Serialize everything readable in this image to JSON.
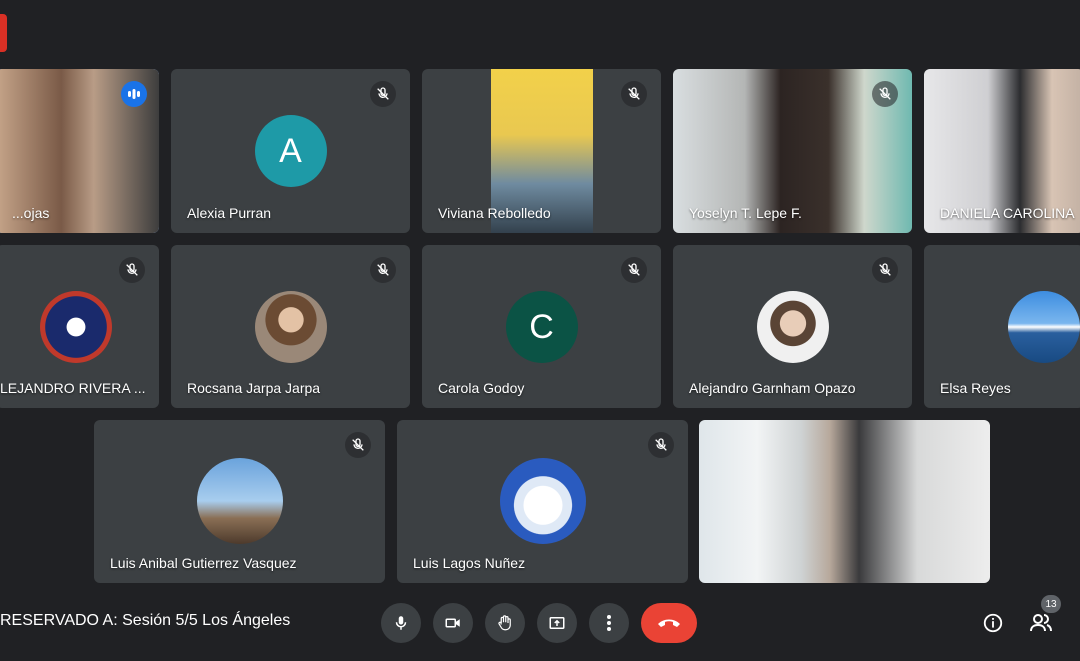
{
  "meeting": {
    "title": "RESERVADO A: Sesión 5/5 Los Ángeles",
    "participant_count": "13"
  },
  "participants": [
    {
      "name": "...ojas"
    },
    {
      "name": "Alexia Purran",
      "initial": "A"
    },
    {
      "name": "Viviana Rebolledo"
    },
    {
      "name": "Yoselyn T. Lepe F."
    },
    {
      "name": "DANIELA CAROLINA"
    },
    {
      "name": "LEJANDRO RIVERA ..."
    },
    {
      "name": "Rocsana Jarpa Jarpa"
    },
    {
      "name": "Carola Godoy",
      "initial": "C"
    },
    {
      "name": "Alejandro Garnham Opazo"
    },
    {
      "name": "Elsa Reyes"
    },
    {
      "name": "Luis Anibal Gutierrez Vasquez"
    },
    {
      "name": "Luis Lagos Nuñez"
    }
  ],
  "colors": {
    "background": "#202124",
    "tile": "#3c4043",
    "active_outline": "#8ab4f8",
    "end_call": "#ea4335",
    "avatar_A": "#1e9aa7",
    "avatar_C": "#0b5345"
  },
  "icons": [
    "mic-off-icon",
    "microphone-icon",
    "camera-icon",
    "hand-icon",
    "present-icon",
    "more-icon",
    "hangup-icon",
    "info-icon",
    "people-icon"
  ]
}
